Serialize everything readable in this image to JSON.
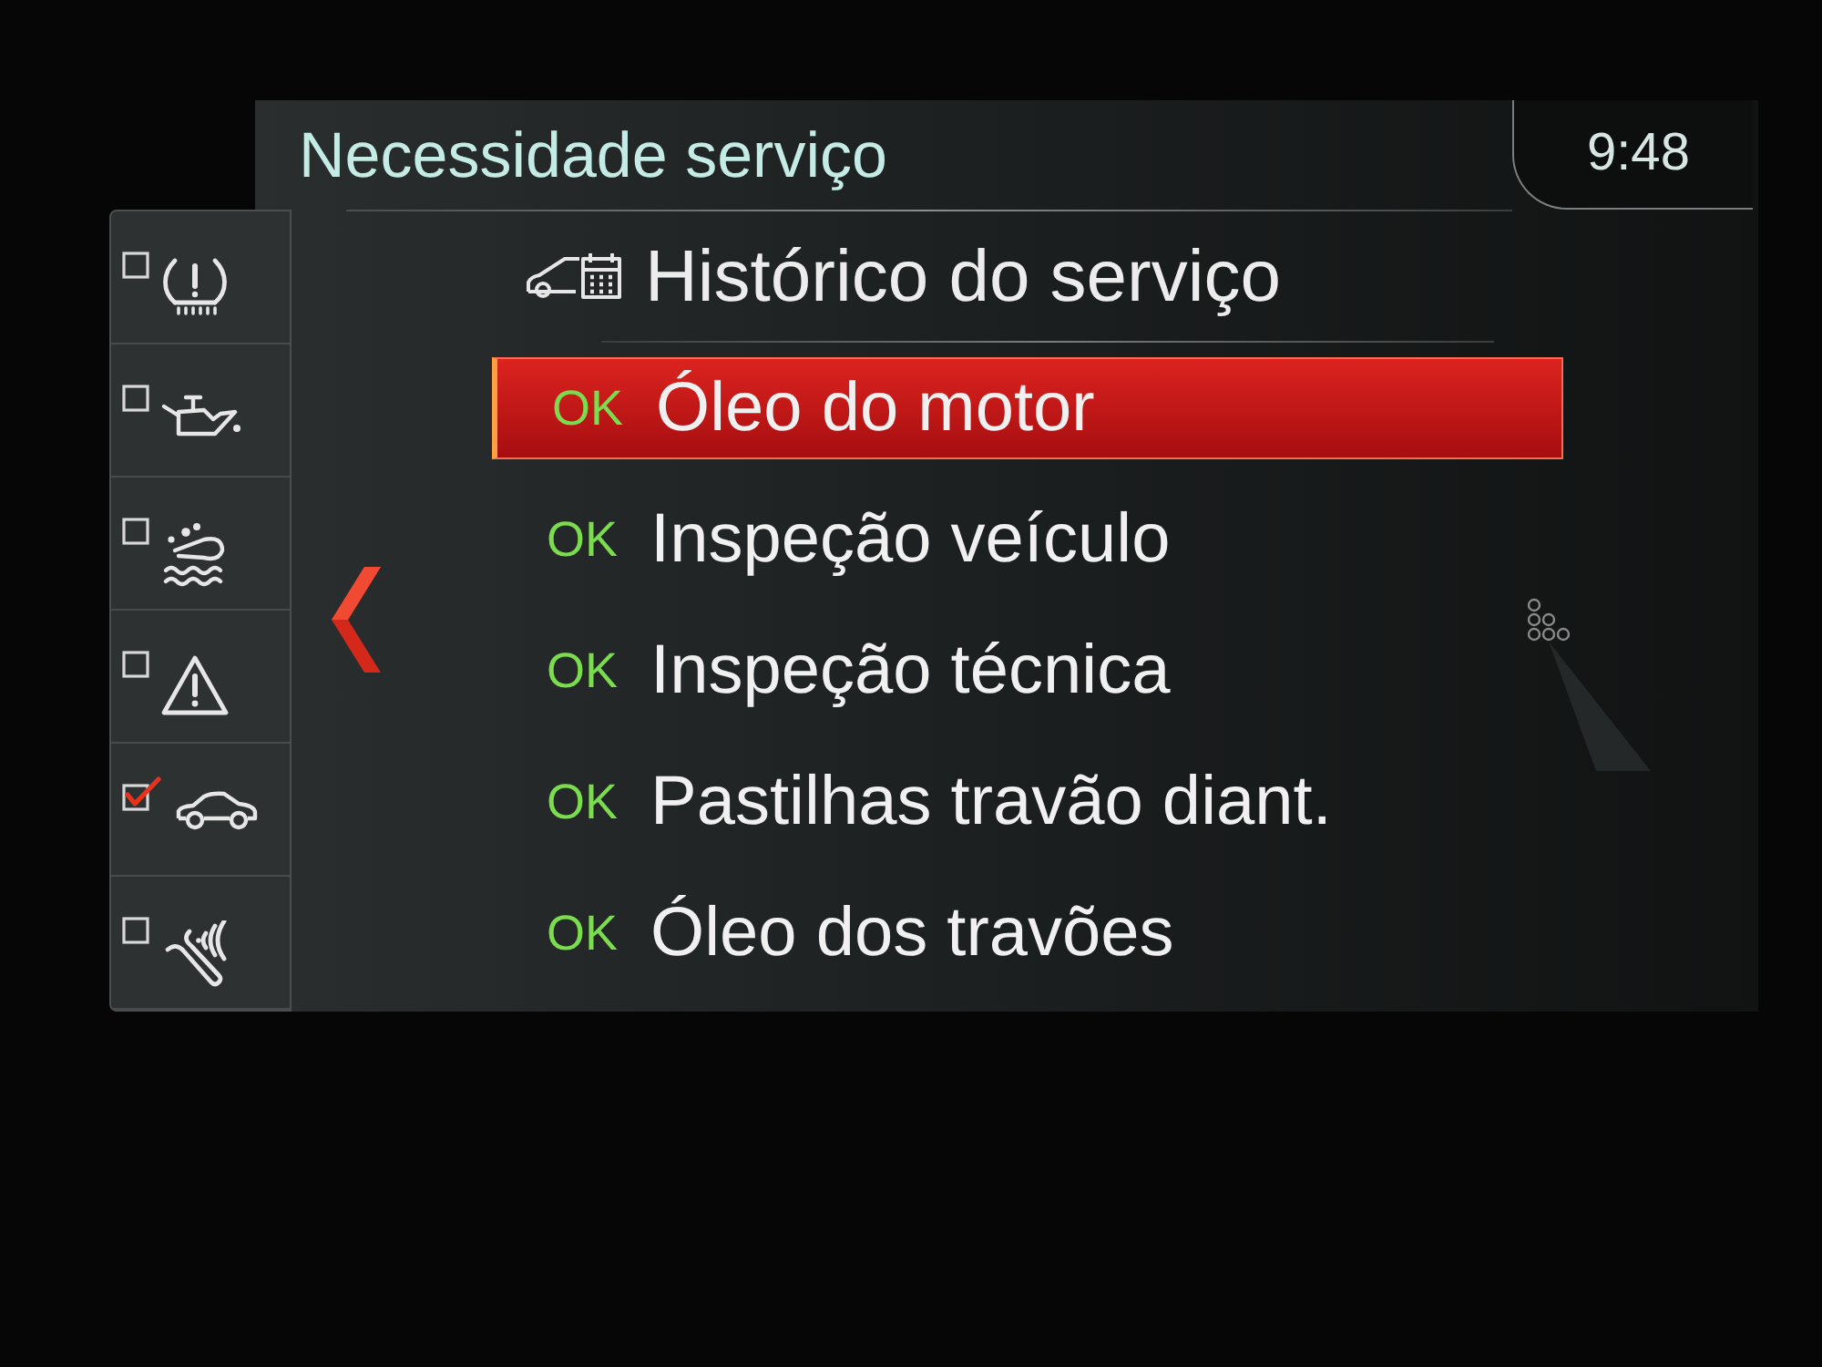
{
  "header": {
    "title": "Necessidade serviço",
    "clock": "9:48"
  },
  "sidebar": {
    "items": [
      {
        "kind": "tire",
        "checked": false
      },
      {
        "kind": "oil",
        "checked": false
      },
      {
        "kind": "fluid",
        "checked": false
      },
      {
        "kind": "warning",
        "checked": false
      },
      {
        "kind": "car",
        "checked": true
      },
      {
        "kind": "wrench",
        "checked": false
      }
    ]
  },
  "history": {
    "label": "Histórico do serviço"
  },
  "services": [
    {
      "status": "OK",
      "label": "Óleo do motor",
      "selected": true
    },
    {
      "status": "OK",
      "label": "Inspeção veículo",
      "selected": false
    },
    {
      "status": "OK",
      "label": "Inspeção técnica",
      "selected": false
    },
    {
      "status": "OK",
      "label": "Pastilhas travão diant.",
      "selected": false
    },
    {
      "status": "OK",
      "label": "Óleo dos travões",
      "selected": false
    }
  ]
}
